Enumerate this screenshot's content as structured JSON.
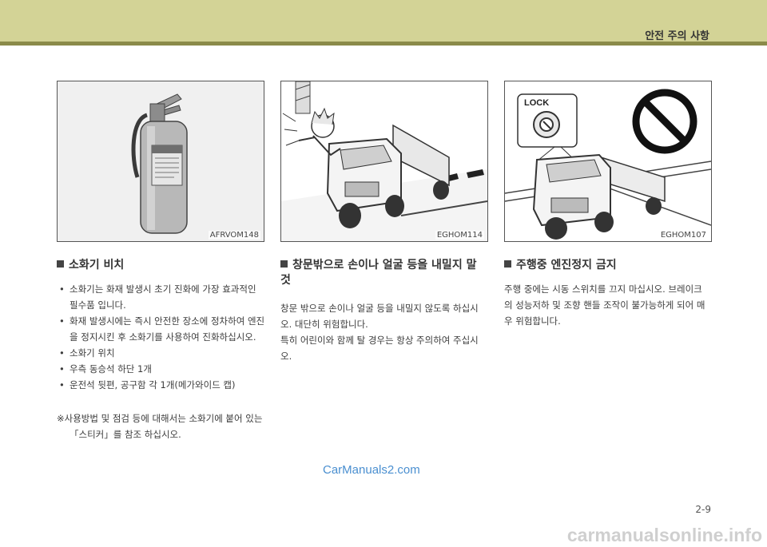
{
  "header": {
    "title": "안전 주의 사항"
  },
  "figures": [
    {
      "code": "AFRVOM148",
      "icon": "fire-extinguisher-icon"
    },
    {
      "code": "EGHOM114",
      "icon": "truck-child-window-icon"
    },
    {
      "code": "EGHOM107",
      "icon": "truck-engine-stop-icon",
      "lock_label": "LOCK"
    }
  ],
  "sections": {
    "extinguisher": {
      "title": "소화기 비치",
      "bullets": [
        "소화기는 화재 발생시 초기 진화에 가장 효과적인 필수품 입니다.",
        "화재 발생시에는 즉시 안전한 장소에 정차하여 엔진을 정지시킨 후 소화기를 사용하여 진화하십시오.",
        "소화기 위치",
        "우측 동승석 하단 1개",
        "운전석 뒷편, 공구함 각 1개(메가와이드 캡)"
      ],
      "note": "※사용방법 및 점검 등에 대해서는 소화기에 붙어 있는 「스티커」를 참조 하십시오."
    },
    "window": {
      "title": "창문밖으로 손이나 얼굴 등을 내밀지 말 것",
      "paragraphs": [
        "창문 밖으로 손이나 얼굴 등을 내밀지 않도록 하십시오. 대단히 위험합니다.",
        "특히 어린이와 함께 탈 경우는 항상 주의하여 주십시오."
      ]
    },
    "engine": {
      "title": "주행중 엔진정지 금지",
      "paragraph": "주행 중에는 시동 스위치를 끄지 마십시오. 브레이크의 성능저하 및 조향 핸들 조작이 불가능하게 되어 매우 위험합니다."
    }
  },
  "watermark_top": "CarManuals2.com",
  "page_number": "2-9",
  "watermark_bottom": "carmanualsonline.info"
}
